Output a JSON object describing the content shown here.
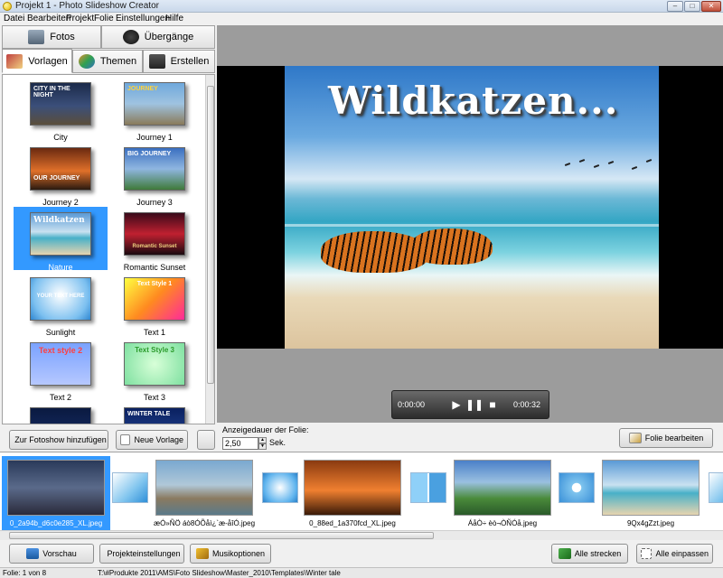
{
  "window": {
    "title": "Projekt 1 - Photo Slideshow Creator"
  },
  "menu": [
    "Datei",
    "Bearbeiten",
    "Projekt",
    "Folie",
    "Einstellungen",
    "Hilfe"
  ],
  "tabs": {
    "top": [
      {
        "label": "Fotos",
        "icon": "photos-icon"
      },
      {
        "label": "Übergänge",
        "icon": "transitions-icon"
      }
    ],
    "sub": [
      {
        "label": "Vorlagen",
        "icon": "templates-icon"
      },
      {
        "label": "Themen",
        "icon": "themes-icon"
      },
      {
        "label": "Erstellen",
        "icon": "create-icon"
      }
    ]
  },
  "templates": [
    {
      "label": "City",
      "overlay": "CITY IN THE NIGHT",
      "bg": "linear-gradient(#1b2a4a, #3b4f7a 55%, #5a4e3a)"
    },
    {
      "label": "Journey 1",
      "overlay": "JOURNEY",
      "bg": "linear-gradient(#6fa8dc, #9fc3e0 50%, #8a7a5a)"
    },
    {
      "label": "Journey 2",
      "overlay": "OUR JOURNEY",
      "bg": "linear-gradient(#6a2a10, #e0702a 55%, #2a1a10)"
    },
    {
      "label": "Journey 3",
      "overlay": "BIG JOURNEY",
      "bg": "linear-gradient(#3a6fc0, #8fb6e0 50%, #3f7a3a)"
    },
    {
      "label": "Nature",
      "overlay": "Wildkatzen",
      "bg": "linear-gradient(#5a9ad6, #c9e1f0 45%, #48b0c8 60%, #e6d4b0)"
    },
    {
      "label": "Romantic Sunset",
      "overlay": "Romantic Sunset",
      "bg": "linear-gradient(#3a0a1a, #c02030 50%, #1a0a10)"
    },
    {
      "label": "Sunlight",
      "overlay": "YOUR TEXT HERE",
      "bg": "radial-gradient(circle at 50% 40%, #ffffff, #7cc0f0 70%, #2f86d0)"
    },
    {
      "label": "Text 1",
      "overlay": "Text Style 1",
      "bg": "linear-gradient(135deg, #ffff40, #ff8a20 50%, #ff2a9a)"
    },
    {
      "label": "Text 2",
      "overlay": "Text style 2",
      "bg": "linear-gradient(#7aa2ff, #b6c8ff)"
    },
    {
      "label": "Text 3",
      "overlay": "Text Style 3",
      "bg": "radial-gradient(circle, #d8ffd8, #7ee0a0)"
    },
    {
      "label": "",
      "overlay": "",
      "bg": "linear-gradient(#0a1a40, #1a3070)"
    },
    {
      "label": "",
      "overlay": "WINTER TALE",
      "bg": "linear-gradient(#0a2060, #2a50a0)"
    }
  ],
  "left_buttons": {
    "add": "Zur Fotoshow hinzufügen",
    "new_template": "Neue Vorlage"
  },
  "preview": {
    "slide_title": "Wildkatzen...",
    "time_current": "0:00:00",
    "time_total": "0:00:32"
  },
  "duration": {
    "label": "Anzeigedauer der Folie:",
    "value": "2,50",
    "unit": "Sek."
  },
  "edit_button": "Folie bearbeiten",
  "filmstrip": [
    {
      "name": "0_2a94b_d6c0e285_XL.jpeg",
      "bg": "linear-gradient(#2a3a5a, #5a6a8a 50%, #2a2a3a)"
    },
    {
      "name": "æÓ»ÑÖ áò8ÓÕåì¿`æ-åîÓ.jpeg",
      "bg": "linear-gradient(#7aa8d0, #b0c8d8 45%, #8a7a60 70%, #5a7a8a)"
    },
    {
      "name": "0_88ed_1a370fcd_XL.jpeg",
      "bg": "linear-gradient(#8a3a10, #f08030 55%, #3a1a08)"
    },
    {
      "name": "ÁåÒ÷ èò¬ÒÑÓå.jpeg",
      "bg": "linear-gradient(#4a80c8, #9ac0e0 40%, #4a8a3a 70%, #2a5a2a)"
    },
    {
      "name": "9Qx4gZzt.jpeg",
      "bg": "linear-gradient(#5a9ad6, #c9e1f0 45%, #48b0c8 60%, #e6d4b0)"
    }
  ],
  "bottom_buttons": {
    "preview": "Vorschau",
    "project_settings": "Projekteinstellungen",
    "music_options": "Musikoptionen",
    "stretch_all": "Alle strecken",
    "fit_all": "Alle einpassen"
  },
  "status": {
    "slide": "Folie: 1 von 8",
    "path": "T:\\#Produkte 2011\\AMS\\Foto Slideshow\\Master_2010\\Templates\\Winter tale"
  }
}
